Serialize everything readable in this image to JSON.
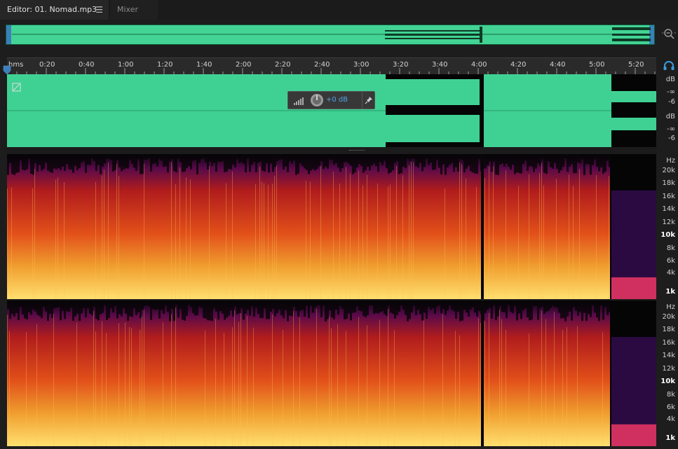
{
  "tabs": [
    {
      "label": "Editor: 01. Nomad.mp3",
      "menu": "☰"
    },
    {
      "label": "Mixer"
    }
  ],
  "ruler": {
    "unit": "hms",
    "ticks": [
      "0:20",
      "0:40",
      "1:00",
      "1:20",
      "1:40",
      "2:00",
      "2:20",
      "2:40",
      "3:00",
      "3:20",
      "3:40",
      "4:00",
      "4:20",
      "4:40",
      "5:00",
      "5:20"
    ]
  },
  "hud": {
    "gain": "+0 dB"
  },
  "db_scale": {
    "ch1": [
      "dB",
      "-∞",
      "-6"
    ],
    "ch2": [
      "dB",
      "-∞",
      "-6"
    ]
  },
  "hz_scale": [
    "Hz",
    "20k",
    "18k",
    "16k",
    "14k",
    "12k",
    "10k",
    "8k",
    "6k",
    "4k",
    "1k"
  ],
  "colors": {
    "waveform": "#3fd193",
    "accent": "#3a7fb8",
    "gain_text": "#4fa3e8"
  },
  "icons": {
    "zoom": "zoom-out-icon",
    "monitor": "headphones-icon",
    "pin": "pin-icon",
    "knob": "gain-knob-icon"
  }
}
